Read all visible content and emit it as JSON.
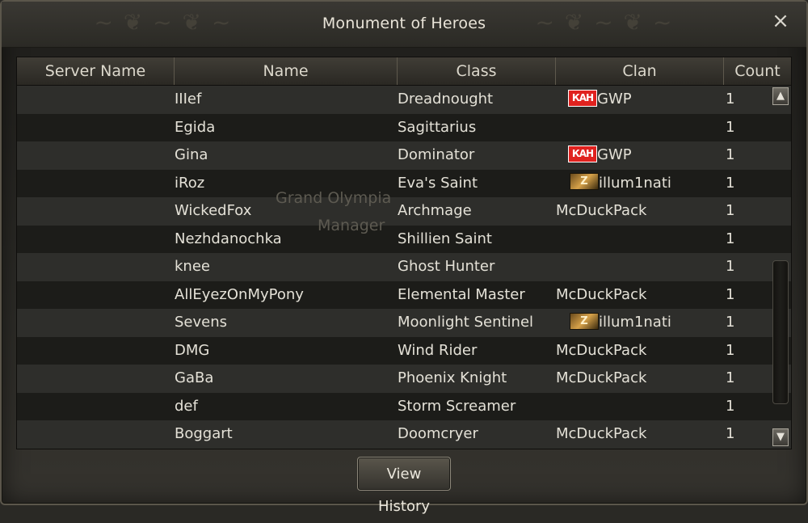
{
  "window": {
    "title": "Monument of Heroes",
    "close_glyph": "×"
  },
  "columns": [
    "Server Name",
    "Name",
    "Class",
    "Clan",
    "Count"
  ],
  "rows": [
    {
      "name": "IIIef",
      "class": "Dreadnought",
      "clan": "GWP",
      "crest": "red",
      "crest_text": "КАН",
      "count": "1"
    },
    {
      "name": "Egida",
      "class": "Sagittarius",
      "clan": "",
      "crest": "",
      "crest_text": "",
      "count": "1"
    },
    {
      "name": "Gina",
      "class": "Dominator",
      "clan": "GWP",
      "crest": "red",
      "crest_text": "КАН",
      "count": "1"
    },
    {
      "name": "iRoz",
      "class": "Eva's Saint",
      "clan": "illum1nati",
      "crest": "gold",
      "crest_text": "Z",
      "count": "1"
    },
    {
      "name": "WickedFox",
      "class": "Archmage",
      "clan": "McDuckPack",
      "crest": "",
      "crest_text": "",
      "count": "1"
    },
    {
      "name": "Nezhdanochka",
      "class": "Shillien Saint",
      "clan": "",
      "crest": "",
      "crest_text": "",
      "count": "1"
    },
    {
      "name": "knee",
      "class": "Ghost Hunter",
      "clan": "",
      "crest": "",
      "crest_text": "",
      "count": "1"
    },
    {
      "name": "AllEyezOnMyPony",
      "class": "Elemental Master",
      "clan": "McDuckPack",
      "crest": "",
      "crest_text": "",
      "count": "1"
    },
    {
      "name": "Sevens",
      "class": "Moonlight Sentinel",
      "clan": "illum1nati",
      "crest": "gold",
      "crest_text": "Z",
      "count": "1"
    },
    {
      "name": "DMG",
      "class": "Wind Rider",
      "clan": "McDuckPack",
      "crest": "",
      "crest_text": "",
      "count": "1"
    },
    {
      "name": "GaBa",
      "class": "Phoenix Knight",
      "clan": "McDuckPack",
      "crest": "",
      "crest_text": "",
      "count": "1"
    },
    {
      "name": "def",
      "class": "Storm Screamer",
      "clan": "",
      "crest": "",
      "crest_text": "",
      "count": "1"
    },
    {
      "name": "Boggart",
      "class": "Doomcryer",
      "clan": "McDuckPack",
      "crest": "",
      "crest_text": "",
      "count": "1"
    }
  ],
  "background_text": {
    "line1": "Grand Olympia",
    "line2": "Manager"
  },
  "scrollbar": {
    "up_glyph": "▲",
    "down_glyph": "▼"
  },
  "buttons": {
    "view_history": "View History"
  },
  "colors": {
    "crest_red": "#e0221f",
    "crest_gold": "#d7a24a"
  },
  "icons": [
    "close-icon",
    "scroll-up-icon",
    "scroll-down-icon",
    "clan-crest-icon"
  ]
}
